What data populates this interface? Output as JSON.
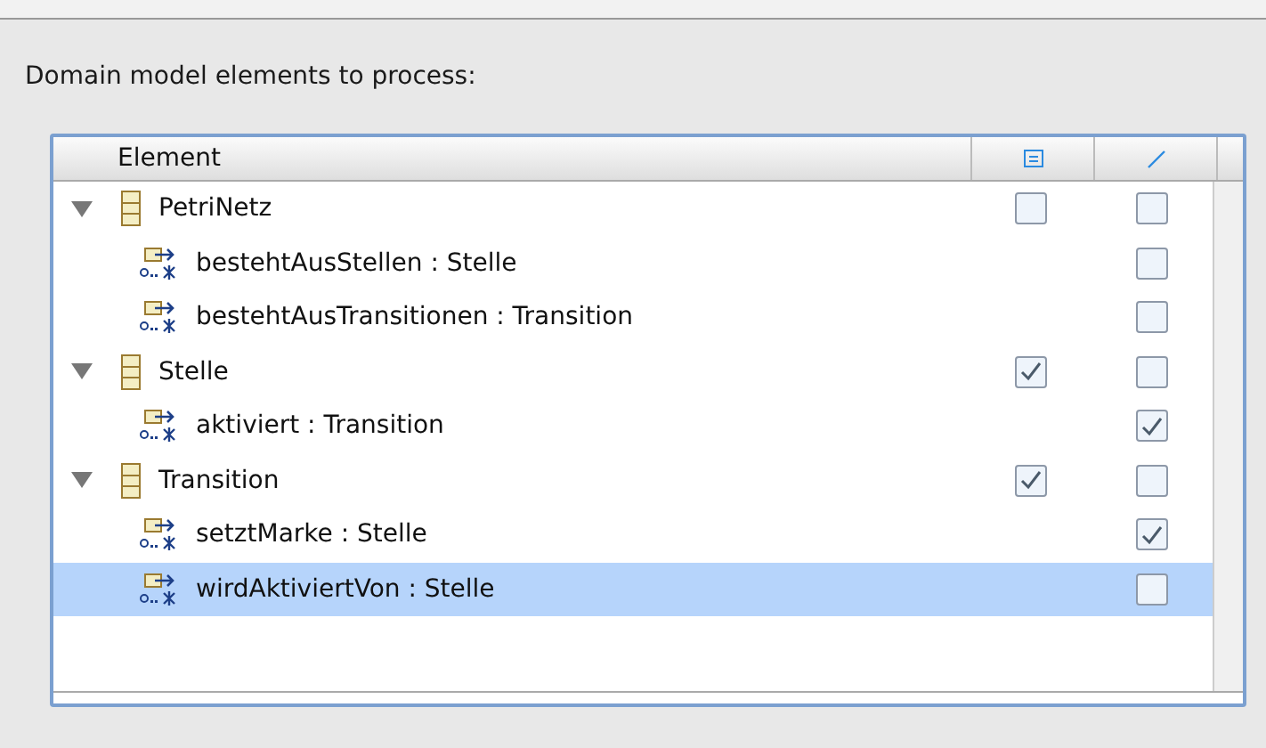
{
  "label": "Domain model elements to process:",
  "table": {
    "columns": [
      {
        "label": "Element"
      },
      {
        "kind": "list-icon"
      },
      {
        "kind": "pen-icon"
      }
    ],
    "rows": [
      {
        "kind": "class",
        "label": "PetriNetz",
        "expanded": true,
        "selected": false,
        "checked_1": false,
        "checked_2": false,
        "children": [
          {
            "kind": "reference",
            "label": "bestehtAusStellen : Stelle",
            "selected": false,
            "checked_2": false
          },
          {
            "kind": "reference",
            "label": "bestehtAusTransitionen : Transition",
            "selected": false,
            "checked_2": false
          }
        ]
      },
      {
        "kind": "class",
        "label": "Stelle",
        "expanded": true,
        "selected": false,
        "checked_1": true,
        "checked_2": false,
        "children": [
          {
            "kind": "reference",
            "label": "aktiviert : Transition",
            "selected": false,
            "checked_2": true
          }
        ]
      },
      {
        "kind": "class",
        "label": "Transition",
        "expanded": true,
        "selected": false,
        "checked_1": true,
        "checked_2": false,
        "children": [
          {
            "kind": "reference",
            "label": "setztMarke : Stelle",
            "selected": false,
            "checked_2": true
          },
          {
            "kind": "reference",
            "label": "wirdAktiviertVon : Stelle",
            "selected": true,
            "checked_2": false
          }
        ]
      }
    ]
  }
}
